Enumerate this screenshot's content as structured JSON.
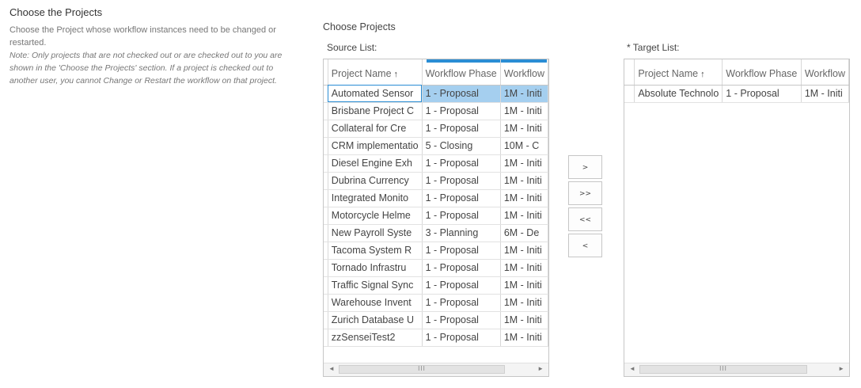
{
  "section": {
    "title": "Choose the Projects",
    "description": "Choose the Project whose workflow instances need to be changed or restarted.",
    "note": "Note: Only projects that are not checked out or are checked out to you are shown in the 'Choose the Projects' section. If a project is checked out to another user, you cannot Change or Restart the workflow on that project."
  },
  "choose_label": "Choose Projects",
  "source": {
    "label": "Source List:",
    "columns": [
      "Project Name",
      "Workflow Phase",
      "Workflow"
    ],
    "sort_indicator": "↑",
    "rows": [
      {
        "name": "Automated Sensor",
        "phase": "1 - Proposal",
        "workflow": "1M - Initi"
      },
      {
        "name": "Brisbane Project C",
        "phase": "1 - Proposal",
        "workflow": "1M - Initi"
      },
      {
        "name": "Collateral for Cre",
        "phase": "1 - Proposal",
        "workflow": "1M - Initi"
      },
      {
        "name": "CRM implementatio",
        "phase": "5 - Closing",
        "workflow": "10M - C"
      },
      {
        "name": "Diesel Engine Exh",
        "phase": "1 - Proposal",
        "workflow": "1M - Initi"
      },
      {
        "name": "Dubrina Currency",
        "phase": "1 - Proposal",
        "workflow": "1M - Initi"
      },
      {
        "name": "Integrated Monito",
        "phase": "1 - Proposal",
        "workflow": "1M - Initi"
      },
      {
        "name": "Motorcycle Helme",
        "phase": "1 - Proposal",
        "workflow": "1M - Initi"
      },
      {
        "name": "New Payroll Syste",
        "phase": "3 - Planning",
        "workflow": "6M - De"
      },
      {
        "name": "Tacoma System R",
        "phase": "1 - Proposal",
        "workflow": "1M - Initi"
      },
      {
        "name": "Tornado Infrastru",
        "phase": "1 - Proposal",
        "workflow": "1M - Initi"
      },
      {
        "name": "Traffic Signal Sync",
        "phase": "1 - Proposal",
        "workflow": "1M - Initi"
      },
      {
        "name": "Warehouse Invent",
        "phase": "1 - Proposal",
        "workflow": "1M - Initi"
      },
      {
        "name": "Zurich Database U",
        "phase": "1 - Proposal",
        "workflow": "1M - Initi"
      },
      {
        "name": "zzSenseiTest2",
        "phase": "1 - Proposal",
        "workflow": "1M - Initi"
      }
    ]
  },
  "target": {
    "label": "* Target List:",
    "columns": [
      "Project Name",
      "Workflow Phase",
      "Workflow"
    ],
    "sort_indicator": "↑",
    "rows": [
      {
        "name": "Absolute Technolo",
        "phase": "1 - Proposal",
        "workflow": "1M - Initi"
      }
    ]
  },
  "buttons": {
    "move_one": ">",
    "move_all": ">>",
    "remove_all": "<<",
    "remove_one": "<"
  },
  "scroll": {
    "left": "◄",
    "right": "►",
    "grip": "III"
  }
}
